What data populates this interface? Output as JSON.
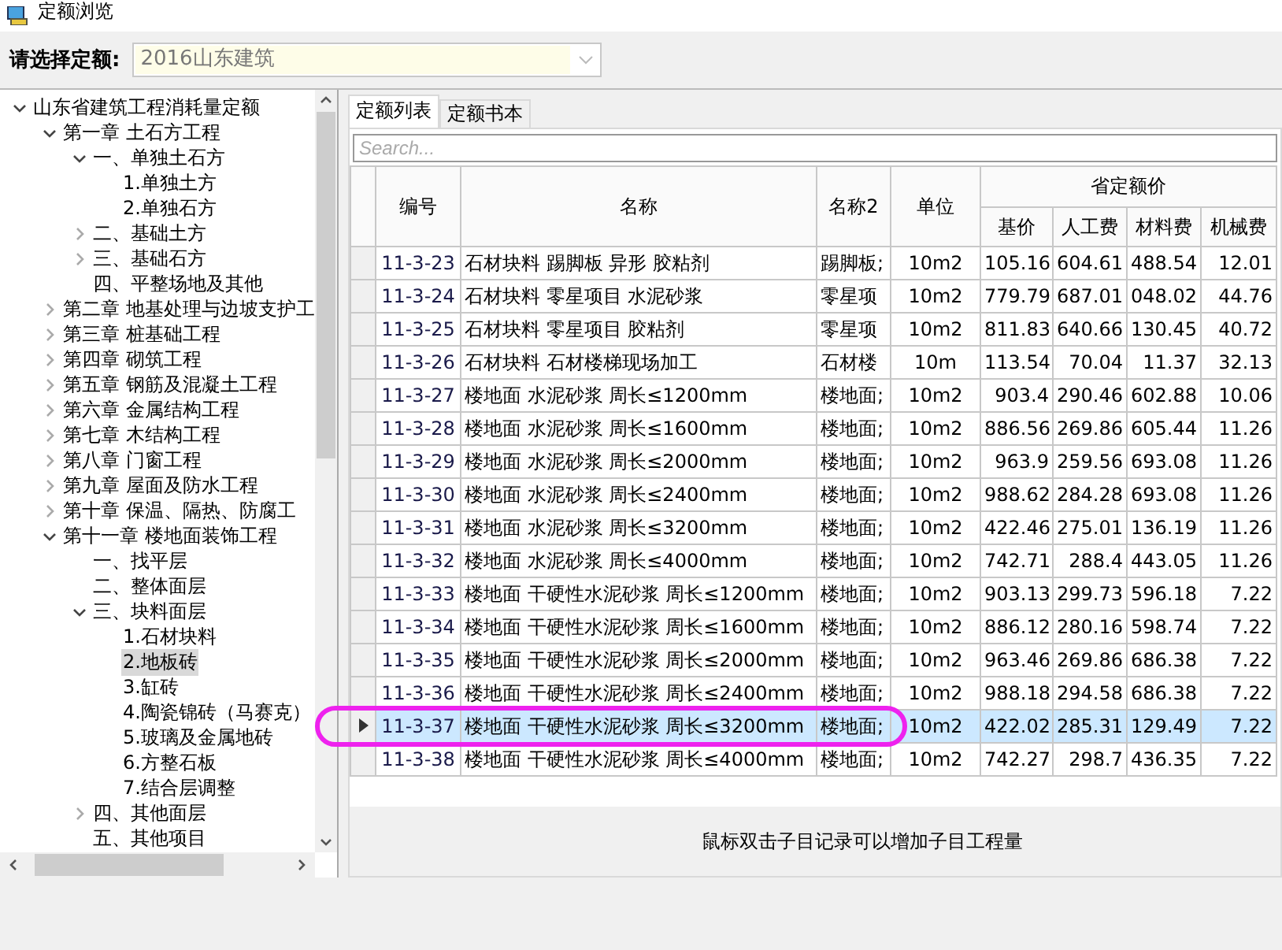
{
  "window": {
    "title": "定额浏览"
  },
  "quota_selector": {
    "label": "请选择定额:",
    "value": "2016山东建筑"
  },
  "tree": [
    {
      "label": "山东省建筑工程消耗量定额",
      "expanded": true,
      "selected": false,
      "children": [
        {
          "label": "第一章 土石方工程",
          "expanded": true,
          "selected": false,
          "children": [
            {
              "label": "一、单独土石方",
              "expanded": true,
              "selected": false,
              "children": [
                {
                  "label": "1.单独土方",
                  "selected": false
                },
                {
                  "label": "2.单独石方",
                  "selected": false
                }
              ]
            },
            {
              "label": "二、基础土方",
              "expanded": false,
              "selected": false
            },
            {
              "label": "三、基础石方",
              "expanded": false,
              "selected": false
            },
            {
              "label": "四、平整场地及其他",
              "selected": false
            }
          ]
        },
        {
          "label": "第二章 地基处理与边坡支护工",
          "expanded": false,
          "selected": false
        },
        {
          "label": "第三章 桩基础工程",
          "expanded": false,
          "selected": false
        },
        {
          "label": "第四章 砌筑工程",
          "expanded": false,
          "selected": false
        },
        {
          "label": "第五章 钢筋及混凝土工程",
          "expanded": false,
          "selected": false
        },
        {
          "label": "第六章 金属结构工程",
          "expanded": false,
          "selected": false
        },
        {
          "label": "第七章 木结构工程",
          "expanded": false,
          "selected": false
        },
        {
          "label": "第八章 门窗工程",
          "expanded": false,
          "selected": false
        },
        {
          "label": "第九章 屋面及防水工程",
          "expanded": false,
          "selected": false
        },
        {
          "label": "第十章 保温、隔热、防腐工",
          "expanded": false,
          "selected": false
        },
        {
          "label": "第十一章 楼地面装饰工程",
          "expanded": true,
          "selected": false,
          "children": [
            {
              "label": "一、找平层",
              "selected": false
            },
            {
              "label": "二、整体面层",
              "selected": false
            },
            {
              "label": "三、块料面层",
              "expanded": true,
              "selected": false,
              "children": [
                {
                  "label": "1.石材块料",
                  "selected": false
                },
                {
                  "label": "2.地板砖",
                  "selected": true
                },
                {
                  "label": "3.缸砖",
                  "selected": false
                },
                {
                  "label": "4.陶瓷锦砖（马赛克）",
                  "selected": false
                },
                {
                  "label": "5.玻璃及金属地砖",
                  "selected": false
                },
                {
                  "label": "6.方整石板",
                  "selected": false
                },
                {
                  "label": "7.结合层调整",
                  "selected": false
                }
              ]
            },
            {
              "label": "四、其他面层",
              "expanded": false,
              "selected": false
            },
            {
              "label": "五、其他项目",
              "selected": false
            }
          ]
        }
      ]
    }
  ],
  "tabs": [
    {
      "label": "定额列表",
      "selected": true
    },
    {
      "label": "定额书本",
      "selected": false
    }
  ],
  "search": {
    "placeholder": "Search..."
  },
  "table": {
    "columns": [
      "编号",
      "名称",
      "名称2",
      "单位"
    ],
    "price_group": {
      "label": "省定额价",
      "columns": [
        "基价",
        "人工费",
        "材料费",
        "机械费"
      ]
    },
    "rows": [
      {
        "cells": [
          "11-3-23",
          "石材块料 踢脚板 异形 胶粘剂",
          "踢脚板;",
          "10m2",
          "105.16",
          "604.61",
          "488.54",
          "12.01"
        ],
        "selected": false
      },
      {
        "cells": [
          "11-3-24",
          "石材块料 零星项目 水泥砂浆",
          "零星项",
          "10m2",
          "779.79",
          "687.01",
          "048.02",
          "44.76"
        ],
        "selected": false
      },
      {
        "cells": [
          "11-3-25",
          "石材块料 零星项目 胶粘剂",
          "零星项",
          "10m2",
          "811.83",
          "640.66",
          "130.45",
          "40.72"
        ],
        "selected": false
      },
      {
        "cells": [
          "11-3-26",
          "石材块料 石材楼梯现场加工",
          "石材楼",
          "10m",
          "113.54",
          "70.04",
          "11.37",
          "32.13"
        ],
        "selected": false
      },
      {
        "cells": [
          "11-3-27",
          "楼地面 水泥砂浆 周长≤1200mm",
          "楼地面;",
          "10m2",
          "903.4",
          "290.46",
          "602.88",
          "10.06"
        ],
        "selected": false
      },
      {
        "cells": [
          "11-3-28",
          "楼地面 水泥砂浆 周长≤1600mm",
          "楼地面;",
          "10m2",
          "886.56",
          "269.86",
          "605.44",
          "11.26"
        ],
        "selected": false
      },
      {
        "cells": [
          "11-3-29",
          "楼地面 水泥砂浆 周长≤2000mm",
          "楼地面;",
          "10m2",
          "963.9",
          "259.56",
          "693.08",
          "11.26"
        ],
        "selected": false
      },
      {
        "cells": [
          "11-3-30",
          "楼地面 水泥砂浆 周长≤2400mm",
          "楼地面;",
          "10m2",
          "988.62",
          "284.28",
          "693.08",
          "11.26"
        ],
        "selected": false
      },
      {
        "cells": [
          "11-3-31",
          "楼地面 水泥砂浆 周长≤3200mm",
          "楼地面;",
          "10m2",
          "422.46",
          "275.01",
          "136.19",
          "11.26"
        ],
        "selected": false
      },
      {
        "cells": [
          "11-3-32",
          "楼地面 水泥砂浆 周长≤4000mm",
          "楼地面;",
          "10m2",
          "742.71",
          "288.4",
          "443.05",
          "11.26"
        ],
        "selected": false
      },
      {
        "cells": [
          "11-3-33",
          "楼地面 干硬性水泥砂浆 周长≤1200mm",
          "楼地面;",
          "10m2",
          "903.13",
          "299.73",
          "596.18",
          "7.22"
        ],
        "selected": false
      },
      {
        "cells": [
          "11-3-34",
          "楼地面 干硬性水泥砂浆 周长≤1600mm",
          "楼地面;",
          "10m2",
          "886.12",
          "280.16",
          "598.74",
          "7.22"
        ],
        "selected": false
      },
      {
        "cells": [
          "11-3-35",
          "楼地面 干硬性水泥砂浆 周长≤2000mm",
          "楼地面;",
          "10m2",
          "963.46",
          "269.86",
          "686.38",
          "7.22"
        ],
        "selected": false
      },
      {
        "cells": [
          "11-3-36",
          "楼地面 干硬性水泥砂浆 周长≤2400mm",
          "楼地面;",
          "10m2",
          "988.18",
          "294.58",
          "686.38",
          "7.22"
        ],
        "selected": false
      },
      {
        "cells": [
          "11-3-37",
          "楼地面 干硬性水泥砂浆 周长≤3200mm",
          "楼地面;",
          "10m2",
          "422.02",
          "285.31",
          "129.49",
          "7.22"
        ],
        "selected": true
      },
      {
        "cells": [
          "11-3-38",
          "楼地面 干硬性水泥砂浆 周长≤4000mm",
          "楼地面;",
          "10m2",
          "742.27",
          "298.7",
          "436.35",
          "7.22"
        ],
        "selected": false
      }
    ]
  },
  "hint": "鼠标双击子目记录可以增加子目工程量"
}
